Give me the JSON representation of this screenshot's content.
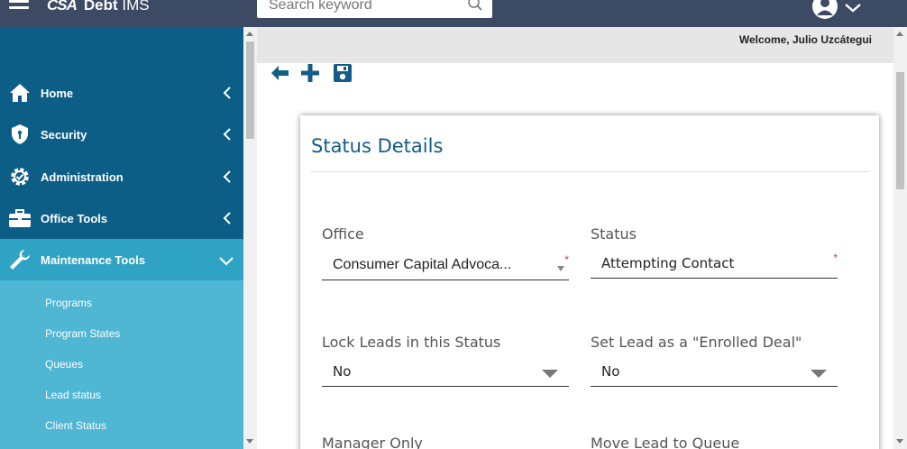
{
  "header": {
    "logo_mark": "CSA",
    "app_name_bold": "Debt",
    "app_name_rest": "IMS",
    "search_placeholder": "Search keyword"
  },
  "welcome_text": "Welcome, Julio Uzcátegui",
  "sidebar": {
    "items": [
      {
        "label": "Home",
        "icon": "home-icon"
      },
      {
        "label": "Security",
        "icon": "shield-icon"
      },
      {
        "label": "Administration",
        "icon": "gear-icon"
      },
      {
        "label": "Office Tools",
        "icon": "briefcase-icon"
      },
      {
        "label": "Maintenance Tools",
        "icon": "wrench-icon",
        "active": true
      }
    ],
    "submenu": [
      "Programs",
      "Program States",
      "Queues",
      "Lead status",
      "Client Status"
    ]
  },
  "toolbar": {
    "back_icon": "arrow-left-icon",
    "add_icon": "plus-icon",
    "save_icon": "save-icon"
  },
  "card": {
    "title": "Status Details",
    "fields": [
      {
        "label": "Office",
        "value": "Consumer Capital Advoca...",
        "required": true,
        "type": "select"
      },
      {
        "label": "Status",
        "value": "Attempting Contact",
        "required": true,
        "type": "text"
      },
      {
        "label": "Lock Leads in this Status",
        "value": "No",
        "type": "select"
      },
      {
        "label": "Set Lead as a \"Enrolled Deal\"",
        "value": "No",
        "type": "select"
      },
      {
        "label": "Manager Only"
      },
      {
        "label": "Move Lead to Queue"
      }
    ]
  },
  "colors": {
    "topbar": "#3c4a63",
    "sidebar": "#0d5e87",
    "active": "#2fa3c4",
    "submenu": "#4fb6d4",
    "title": "#125d86",
    "required": "#e03030"
  }
}
